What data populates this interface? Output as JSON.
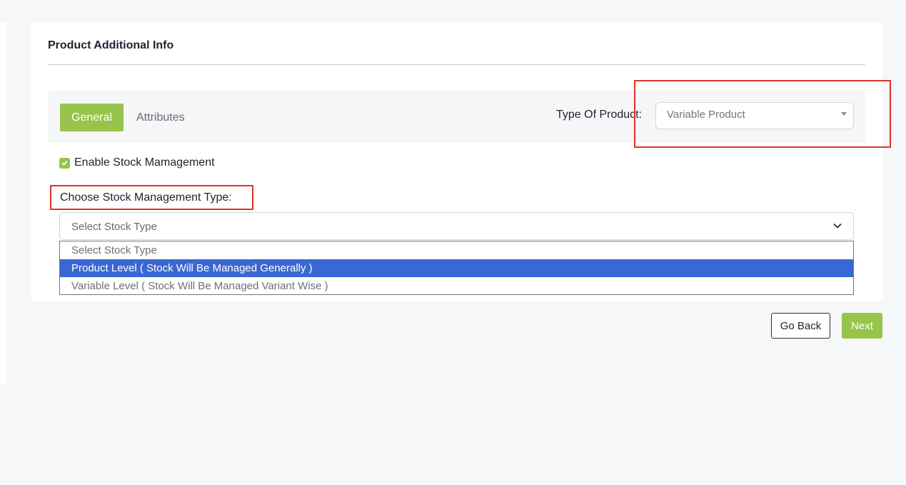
{
  "card": {
    "title": "Product Additional Info"
  },
  "tabs": [
    {
      "label": "General",
      "active": true
    },
    {
      "label": "Attributes",
      "active": false
    }
  ],
  "product_type": {
    "label": "Type Of Product:",
    "value": "Variable Product"
  },
  "stock": {
    "enable_label": "Enable Stock Mamagement",
    "enabled": true,
    "type_label": "Choose Stock Management Type:",
    "select_value": "Select Stock Type",
    "options": [
      {
        "label": "Select Stock Type",
        "highlighted": false
      },
      {
        "label": "Product Level ( Stock Will Be Managed Generally )",
        "highlighted": true
      },
      {
        "label": "Variable Level ( Stock Will Be Managed Variant Wise )",
        "highlighted": false
      }
    ]
  },
  "actions": {
    "back_label": "Go Back",
    "next_label": "Next"
  },
  "colors": {
    "accent": "#97c44a",
    "selection": "#3a68d2",
    "annotation": "#e0332a"
  }
}
